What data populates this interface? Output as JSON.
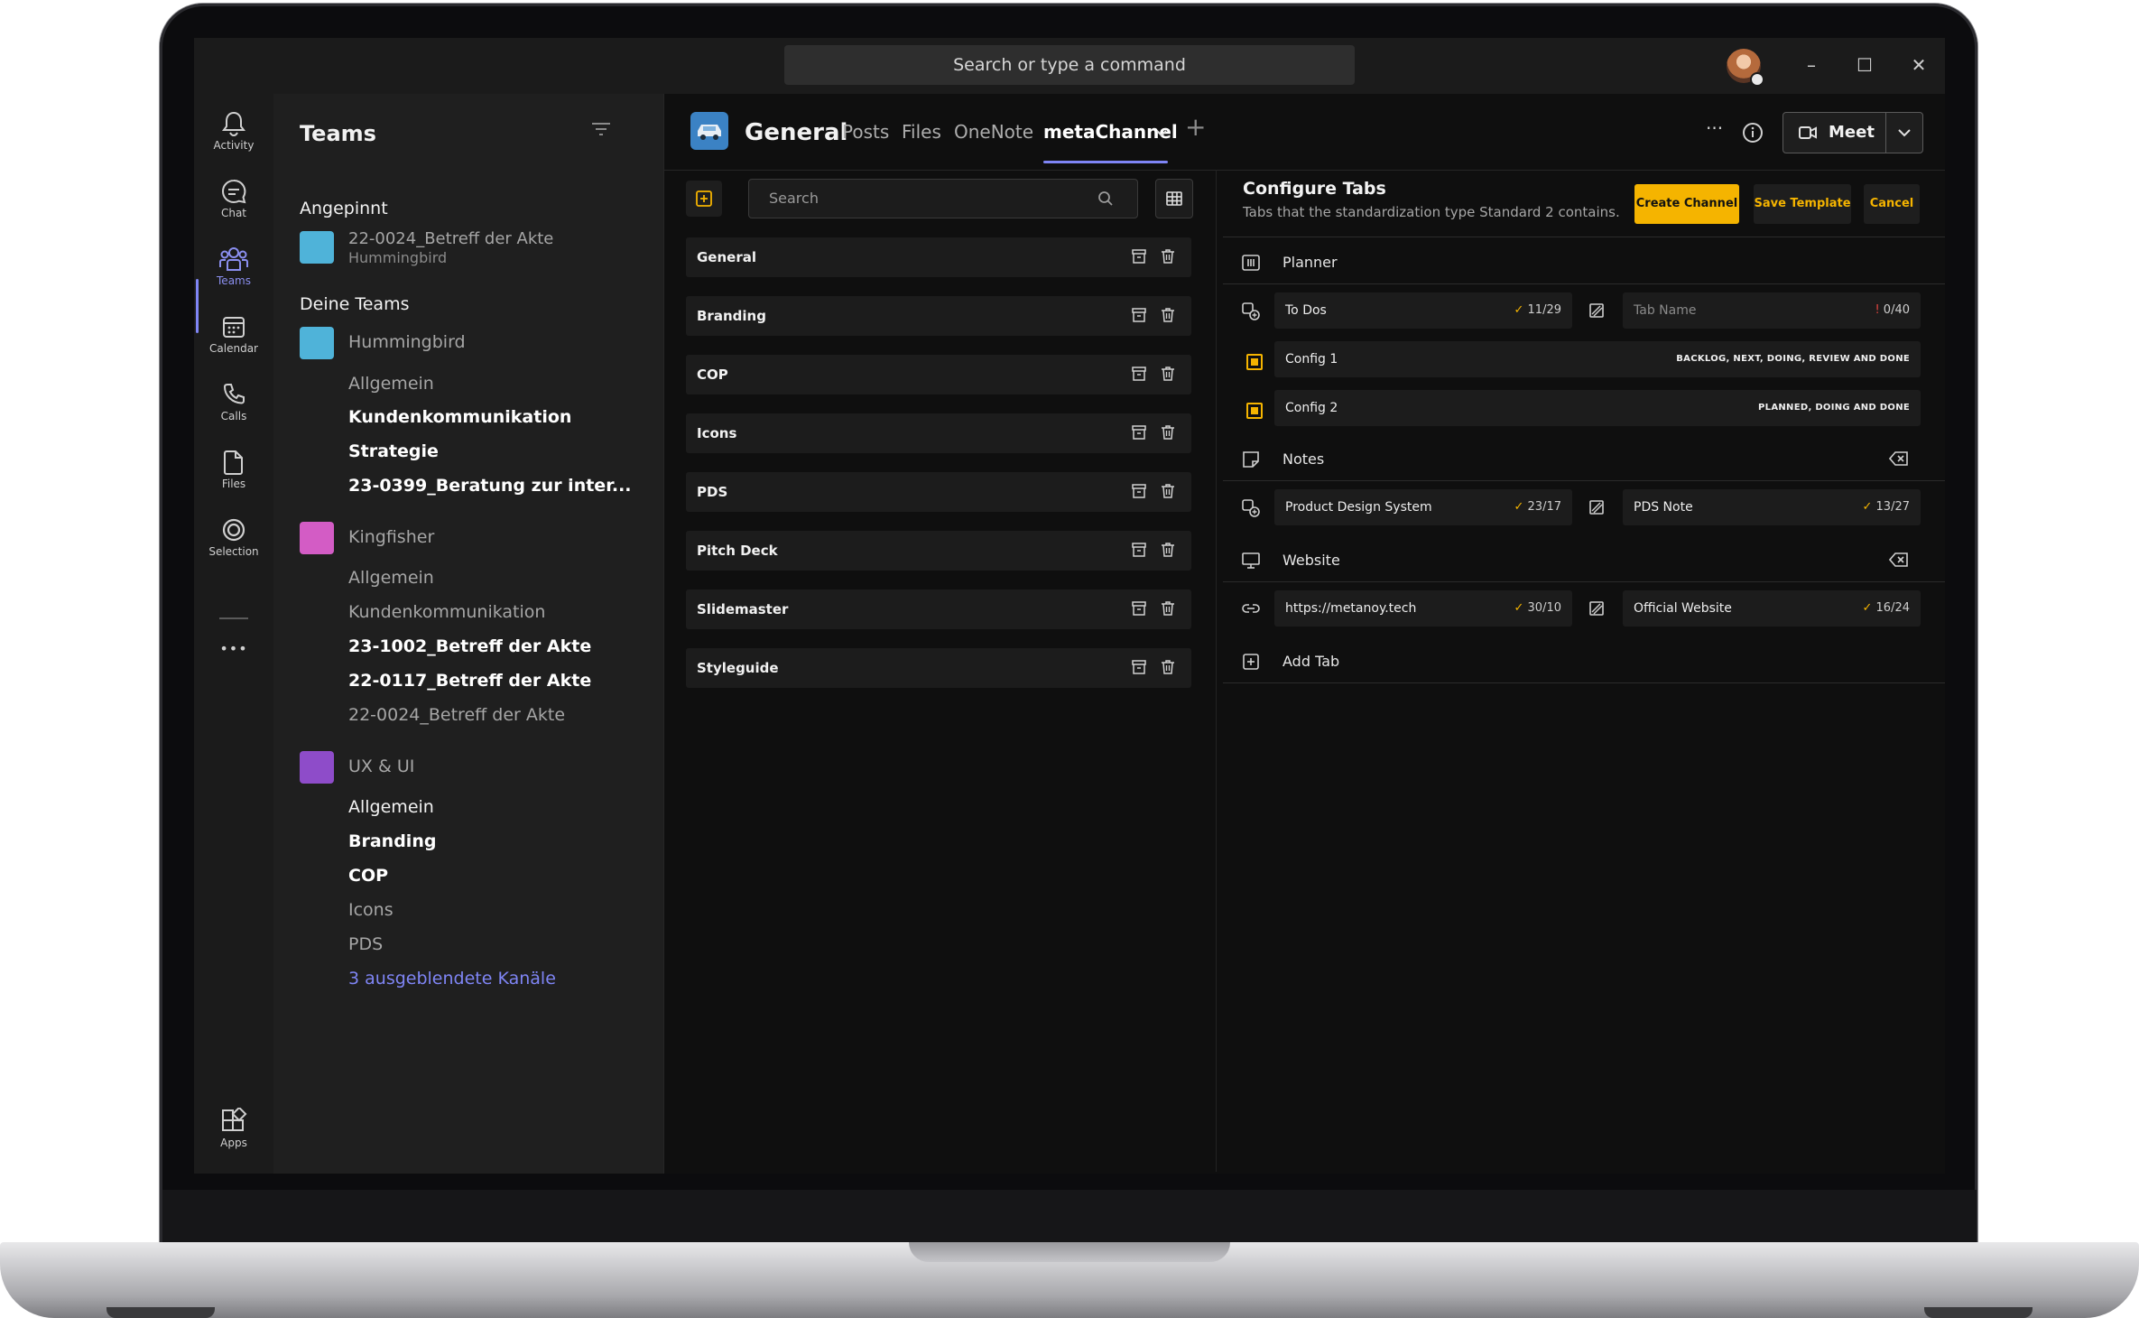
{
  "titlebar": {
    "search_placeholder": "Search or type a command",
    "window_minimize": "–",
    "window_maximize": "☐",
    "window_close": "✕"
  },
  "rail": {
    "items": [
      {
        "label": "Activity",
        "icon": "bell-icon"
      },
      {
        "label": "Chat",
        "icon": "chat-icon"
      },
      {
        "label": "Teams",
        "icon": "teams-icon"
      },
      {
        "label": "Calendar",
        "icon": "calendar-icon"
      },
      {
        "label": "Calls",
        "icon": "phone-icon"
      },
      {
        "label": "Files",
        "icon": "file-icon"
      },
      {
        "label": "Selection",
        "icon": "selection-icon"
      }
    ],
    "more": "•••",
    "apps_label": "Apps"
  },
  "teams_panel": {
    "title": "Teams",
    "pinned_heading": "Angepinnt",
    "pinned_item": {
      "name": "22-0024_Betreff der Akte",
      "sub": "Hummingbird",
      "color": "#4fb3d9"
    },
    "your_teams_heading": "Deine Teams",
    "teams": [
      {
        "name": "Hummingbird",
        "color": "#4fb3d9",
        "channels": [
          "Allgemein",
          "Kundenkommunikation",
          "Strategie",
          "23-0399_Beratung zur inter..."
        ]
      },
      {
        "name": "Kingfisher",
        "color": "#d35cc5",
        "channels": [
          "Allgemein",
          "Kundenkommunikation",
          "23-1002_Betreff der Akte",
          "22-0117_Betreff der Akte",
          "22-0024_Betreff der Akte"
        ]
      },
      {
        "name": "UX & UI",
        "color": "#8e4cc9",
        "channels": [
          "Allgemein",
          "Branding",
          "COP",
          "Icons",
          "PDS"
        ]
      }
    ],
    "hidden_channels": "3 ausgeblendete Kanäle"
  },
  "header": {
    "channel_name": "General",
    "tabs": [
      "Posts",
      "Files",
      "OneNote",
      "metaChannel"
    ],
    "add_tab": "+",
    "more": "···",
    "meet_label": "Meet"
  },
  "channel_list": {
    "search_placeholder": "Search",
    "channels": [
      "General",
      "Branding",
      "COP",
      "Icons",
      "PDS",
      "Pitch Deck",
      "Slidemaster",
      "Styleguide"
    ]
  },
  "config": {
    "title": "Configure Tabs",
    "subtitle": "Tabs that the standardization type Standard 2 contains.",
    "create_channel": "Create Channel",
    "save_template": "Save Template",
    "cancel": "Cancel",
    "accent": "#f5b400",
    "sections": {
      "planner": {
        "title": "Planner",
        "name_field": {
          "value": "To Dos",
          "count": "11/29"
        },
        "tab_name_field": {
          "placeholder": "Tab Name",
          "count": "0/40"
        },
        "config1": {
          "label": "Config 1",
          "hint": "BACKLOG, NEXT, DOING, REVIEW AND DONE"
        },
        "config2": {
          "label": "Config 2",
          "hint": "PLANNED, DOING AND DONE"
        }
      },
      "notes": {
        "title": "Notes",
        "name_field": {
          "value": "Product Design System",
          "count": "23/17"
        },
        "tab_name_field": {
          "value": "PDS Note",
          "count": "13/27"
        }
      },
      "website": {
        "title": "Website",
        "url_field": {
          "value": "https://metanoy.tech",
          "count": "30/10"
        },
        "tab_name_field": {
          "value": "Official Website",
          "count": "16/24"
        }
      },
      "add_tab": "Add Tab"
    }
  }
}
